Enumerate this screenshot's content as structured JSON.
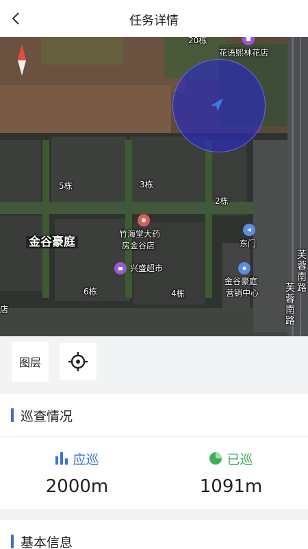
{
  "header": {
    "title": "任务详情",
    "back_icon": "chevron-left-icon"
  },
  "map": {
    "labels": {
      "b20": "20栋",
      "flower_shop": "花语熙林花店",
      "b5": "5栋",
      "b3": "3栋",
      "b2": "2栋",
      "pharmacy_1": "竹海堂大药",
      "pharmacy_2": "房金谷店",
      "community": "金谷豪庭",
      "east_gate": "东门",
      "supermarket": "兴盛超市",
      "b6": "6栋",
      "b4": "4栋",
      "sales_1": "金谷豪庭",
      "sales_2": "营销中心",
      "road_1": "芙蓉南路",
      "road_2": "芙蓉南路",
      "edge_left": "店"
    },
    "colors": {
      "location_circle": "#2828c8",
      "poi_purple": "#9b59d0",
      "poi_red": "#e05a5a",
      "poi_blue": "#5b8de8"
    }
  },
  "controls": {
    "layer_label": "图层",
    "locate_icon": "crosshair-icon"
  },
  "patrol": {
    "title": "巡查情况",
    "required": {
      "label": "应巡",
      "value": "2000m",
      "icon": "bar-chart-icon",
      "color": "#3f72d6"
    },
    "done": {
      "label": "已巡",
      "value": "1091m",
      "icon": "pie-chart-icon",
      "color": "#3fae5a"
    }
  },
  "basic": {
    "title": "基本信息"
  }
}
